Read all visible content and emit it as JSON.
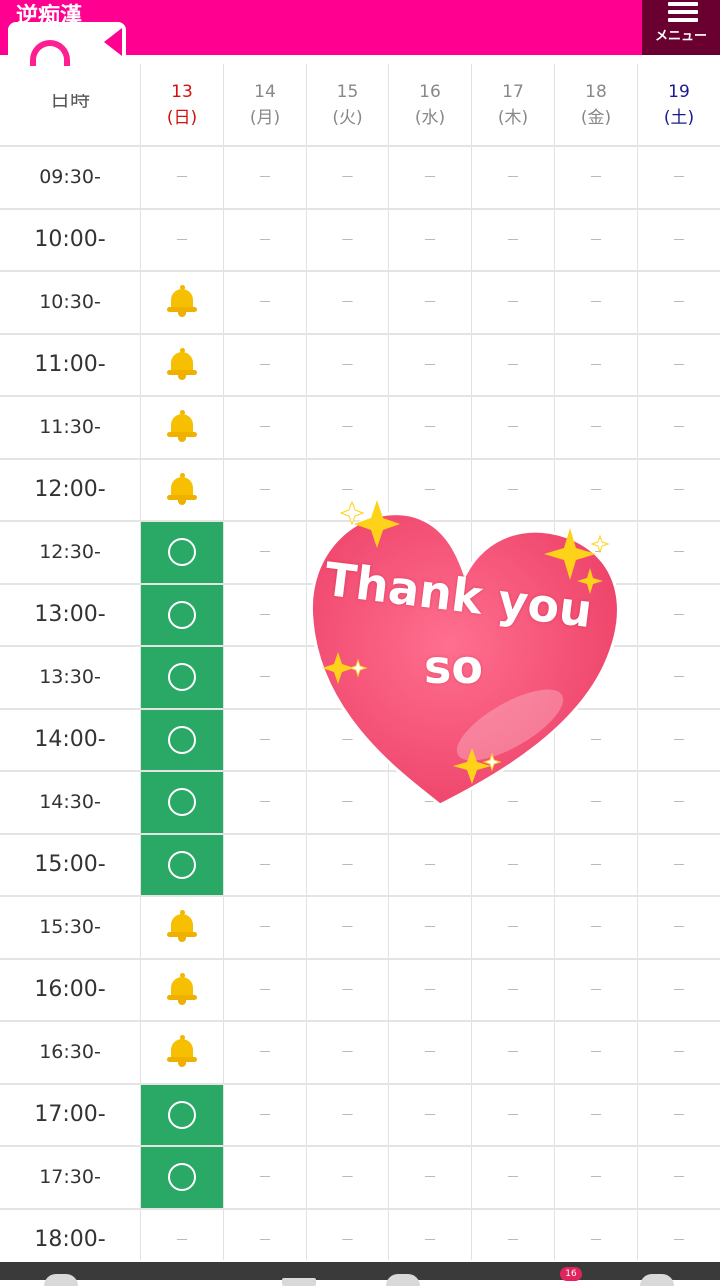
{
  "header": {
    "title": "逆痴漢",
    "menu_label": "メニュー",
    "brand_color": "#ff0090",
    "menu_bg_color": "#6a0030"
  },
  "table": {
    "time_header": "日時",
    "days": [
      {
        "date": "13",
        "weekday": "(日)",
        "type": "sunday"
      },
      {
        "date": "14",
        "weekday": "(月)",
        "type": "weekday"
      },
      {
        "date": "15",
        "weekday": "(火)",
        "type": "weekday"
      },
      {
        "date": "16",
        "weekday": "(水)",
        "type": "weekday"
      },
      {
        "date": "17",
        "weekday": "(木)",
        "type": "weekday"
      },
      {
        "date": "18",
        "weekday": "(金)",
        "type": "weekday"
      },
      {
        "date": "19",
        "weekday": "(土)",
        "type": "saturday"
      }
    ],
    "empty_mark": "－",
    "legend": {
      "open": "green circle (available)",
      "bell": "bell (notify)",
      "dash": "unavailable"
    },
    "open_color": "#2aa865",
    "rows": [
      {
        "time": "09:30-",
        "status": [
          "dash",
          "dash",
          "dash",
          "dash",
          "dash",
          "dash",
          "dash"
        ]
      },
      {
        "time": "10:00-",
        "status": [
          "dash",
          "dash",
          "dash",
          "dash",
          "dash",
          "dash",
          "dash"
        ]
      },
      {
        "time": "10:30-",
        "status": [
          "bell",
          "dash",
          "dash",
          "dash",
          "dash",
          "dash",
          "dash"
        ]
      },
      {
        "time": "11:00-",
        "status": [
          "bell",
          "dash",
          "dash",
          "dash",
          "dash",
          "dash",
          "dash"
        ]
      },
      {
        "time": "11:30-",
        "status": [
          "bell",
          "dash",
          "dash",
          "dash",
          "dash",
          "dash",
          "dash"
        ]
      },
      {
        "time": "12:00-",
        "status": [
          "bell",
          "dash",
          "dash",
          "dash",
          "dash",
          "dash",
          "dash"
        ]
      },
      {
        "time": "12:30-",
        "status": [
          "open",
          "dash",
          "dash",
          "dash",
          "dash",
          "dash",
          "dash"
        ]
      },
      {
        "time": "13:00-",
        "status": [
          "open",
          "dash",
          "dash",
          "dash",
          "dash",
          "dash",
          "dash"
        ]
      },
      {
        "time": "13:30-",
        "status": [
          "open",
          "dash",
          "dash",
          "dash",
          "dash",
          "dash",
          "dash"
        ]
      },
      {
        "time": "14:00-",
        "status": [
          "open",
          "dash",
          "dash",
          "dash",
          "dash",
          "dash",
          "dash"
        ]
      },
      {
        "time": "14:30-",
        "status": [
          "open",
          "dash",
          "dash",
          "dash",
          "dash",
          "dash",
          "dash"
        ]
      },
      {
        "time": "15:00-",
        "status": [
          "open",
          "dash",
          "dash",
          "dash",
          "dash",
          "dash",
          "dash"
        ]
      },
      {
        "time": "15:30-",
        "status": [
          "bell",
          "dash",
          "dash",
          "dash",
          "dash",
          "dash",
          "dash"
        ]
      },
      {
        "time": "16:00-",
        "status": [
          "bell",
          "dash",
          "dash",
          "dash",
          "dash",
          "dash",
          "dash"
        ]
      },
      {
        "time": "16:30-",
        "status": [
          "bell",
          "dash",
          "dash",
          "dash",
          "dash",
          "dash",
          "dash"
        ]
      },
      {
        "time": "17:00-",
        "status": [
          "open",
          "dash",
          "dash",
          "dash",
          "dash",
          "dash",
          "dash"
        ]
      },
      {
        "time": "17:30-",
        "status": [
          "open",
          "dash",
          "dash",
          "dash",
          "dash",
          "dash",
          "dash"
        ]
      },
      {
        "time": "18:00-",
        "status": [
          "dash",
          "dash",
          "dash",
          "dash",
          "dash",
          "dash",
          "dash"
        ]
      }
    ]
  },
  "sticker": {
    "line1": "Thank you",
    "line2": "so",
    "heart_color": "#f04a72",
    "sparkle_color": "#ffd21a"
  },
  "bottom_bar": {
    "badge_count": "16"
  }
}
